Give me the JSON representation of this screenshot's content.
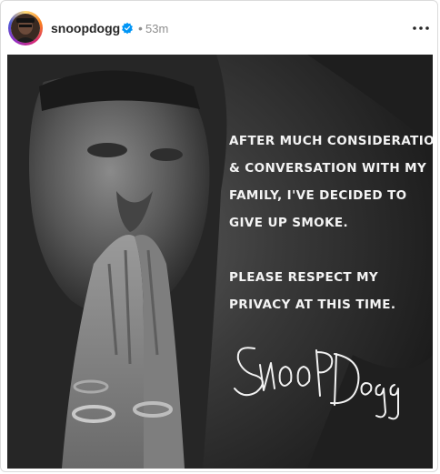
{
  "post": {
    "author": {
      "username": "snoopdogg",
      "verified": true,
      "verified_icon": "verified-badge-icon"
    },
    "separator": "•",
    "timestamp": "53m",
    "more_icon": "more-horizontal-icon",
    "image": {
      "statement_lines": [
        "AFTER MUCH CONSIDERATION",
        "& CONVERSATION WITH MY",
        "FAMILY, I'VE DECIDED TO",
        "GIVE UP SMOKE."
      ],
      "request_lines": [
        "PLEASE RESPECT MY",
        "PRIVACY AT THIS TIME."
      ],
      "signature": "Snoop Dogg"
    }
  },
  "colors": {
    "username": "#262626",
    "muted": "#8e8e8e",
    "verified": "#0095f6",
    "border": "#dbdbdb",
    "post_text": "#f4f4f4"
  }
}
